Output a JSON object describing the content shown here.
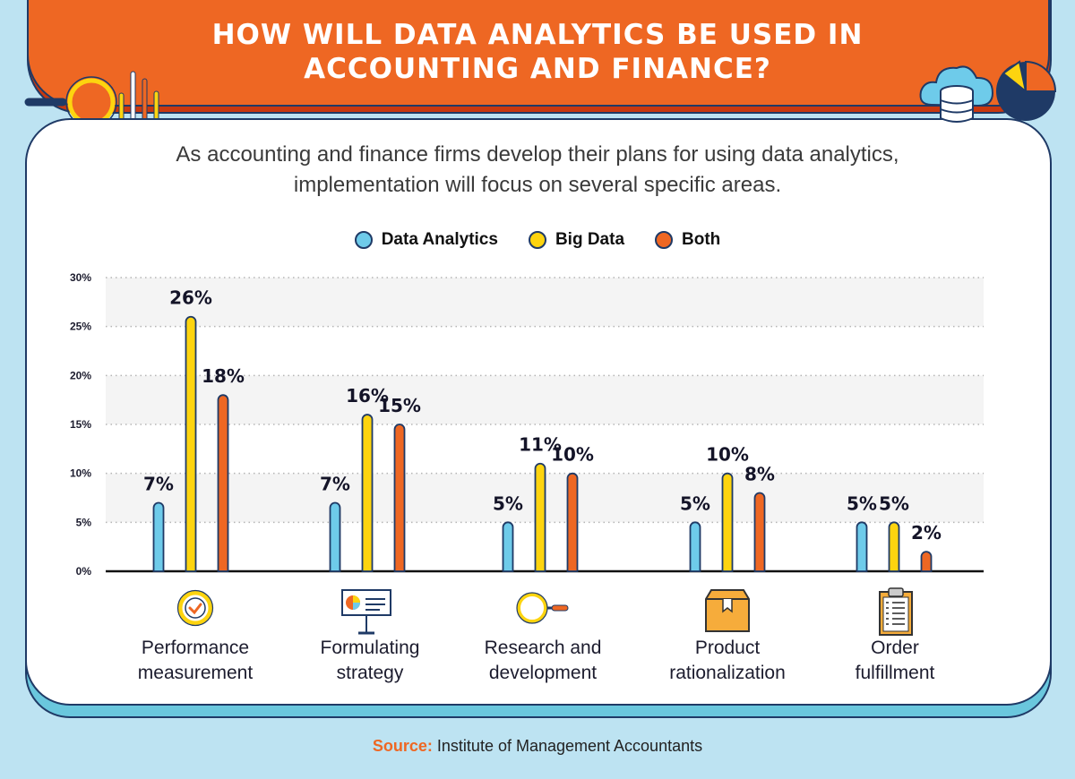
{
  "header": {
    "title_line1": "HOW WILL DATA ANALYTICS BE USED IN",
    "title_line2": "ACCOUNTING AND FINANCE?"
  },
  "subtitle_line1": "As accounting and finance firms develop their plans for using data analytics,",
  "subtitle_line2": "implementation will focus on several specific areas.",
  "colors": {
    "data_analytics": "#6ecbea",
    "big_data": "#fdd40f",
    "both": "#ee6723",
    "outline": "#1f3a66",
    "accent": "#ee6723"
  },
  "categories_icons": [
    "checkmark-badge-icon",
    "presentation-board-icon",
    "magnifying-glass-icon",
    "product-box-icon",
    "clipboard-checklist-icon"
  ],
  "chart_data": {
    "type": "bar",
    "title": "How will data analytics be used in accounting and finance?",
    "xlabel": "",
    "ylabel": "",
    "categories": [
      "Performance measurement",
      "Formulating strategy",
      "Research and development",
      "Product rationalization",
      "Order fulfillment"
    ],
    "category_lines": [
      [
        "Performance",
        "measurement"
      ],
      [
        "Formulating",
        "strategy"
      ],
      [
        "Research and",
        "development"
      ],
      [
        "Product",
        "rationalization"
      ],
      [
        "Order",
        "fulfillment"
      ]
    ],
    "series": [
      {
        "name": "Data Analytics",
        "values": [
          7,
          7,
          5,
          5,
          5
        ]
      },
      {
        "name": "Big Data",
        "values": [
          26,
          16,
          11,
          10,
          5
        ]
      },
      {
        "name": "Both",
        "values": [
          18,
          15,
          10,
          8,
          2
        ]
      }
    ],
    "ylim": [
      0,
      30
    ],
    "yticks": [
      0,
      5,
      10,
      15,
      20,
      25,
      30
    ],
    "ytick_labels": [
      "0%",
      "5%",
      "10%",
      "15%",
      "20%",
      "25%",
      "30%"
    ],
    "value_suffix": "%",
    "grid": true,
    "legend_position": "top-center"
  },
  "legend": [
    {
      "label": "Data Analytics"
    },
    {
      "label": "Big Data"
    },
    {
      "label": "Both"
    }
  ],
  "source": {
    "label": "Source:",
    "text": "Institute of Management Accountants"
  }
}
